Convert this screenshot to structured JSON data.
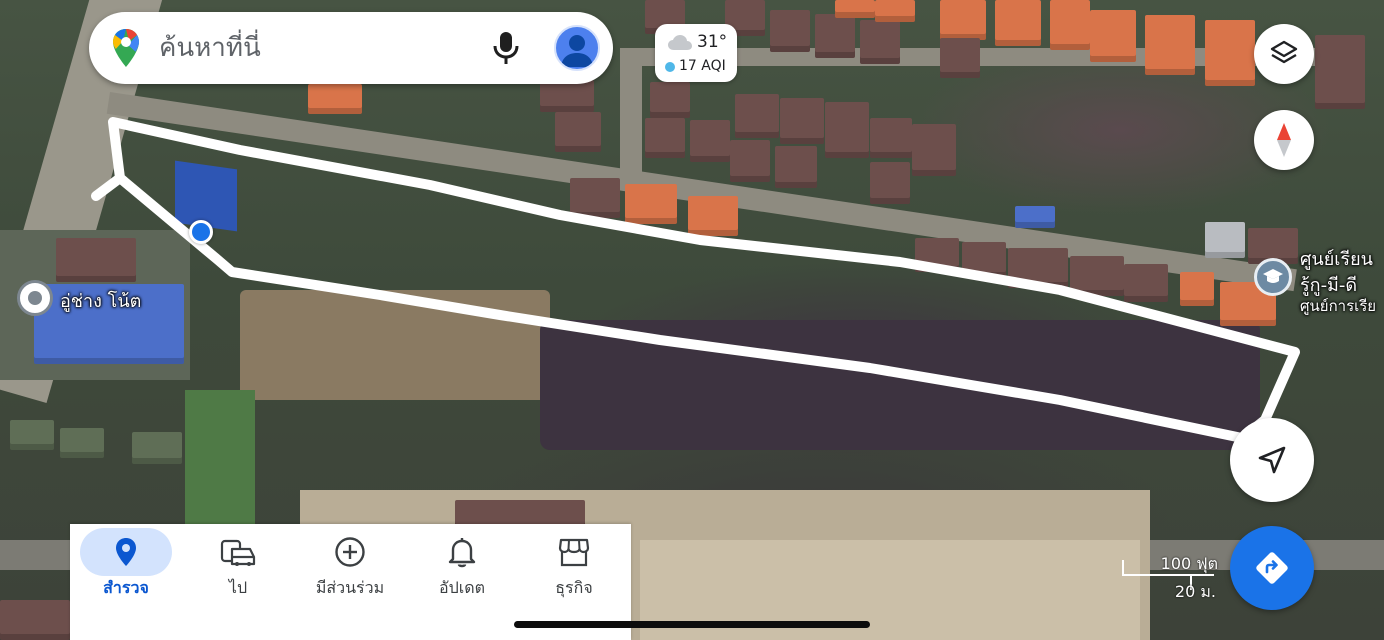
{
  "search": {
    "placeholder": "ค้นหาที่นี่"
  },
  "weather": {
    "temperature": "31°",
    "aqi": "17 AQI"
  },
  "places": [
    {
      "name": "อู่ช่าง โน้ต"
    },
    {
      "name": "ศูนย์เรียน",
      "name_line2": "รู้กู-มี-ดี",
      "subtitle": "ศูนย์การเรีย"
    }
  ],
  "scale": {
    "feet": "100 ฟุต",
    "meters": "20 ม."
  },
  "bottom_nav": {
    "items": [
      {
        "label": "สำรวจ",
        "icon": "location-pin-icon",
        "active": true
      },
      {
        "label": "ไป",
        "icon": "car-icon",
        "active": false
      },
      {
        "label": "มีส่วนร่วม",
        "icon": "add-circle-icon",
        "active": false
      },
      {
        "label": "อัปเดต",
        "icon": "bell-icon",
        "active": false
      },
      {
        "label": "ธุรกิจ",
        "icon": "storefront-icon",
        "active": false
      }
    ]
  },
  "colors": {
    "accent": "#1a73e8",
    "active_pill": "#d3e3fd",
    "drawn_outline": "#ffffff"
  }
}
